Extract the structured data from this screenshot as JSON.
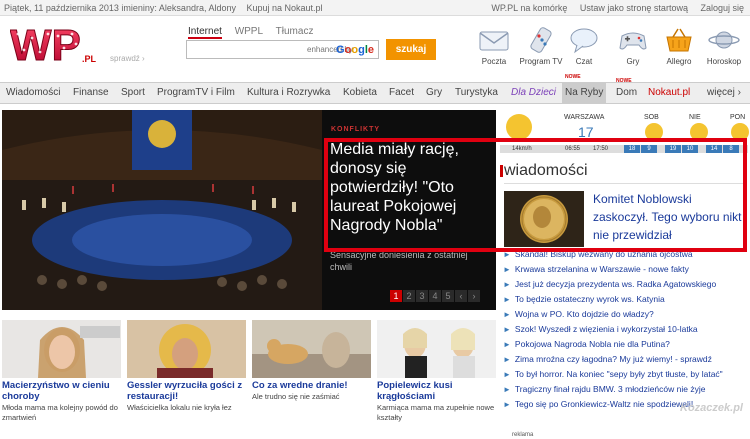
{
  "topbar": {
    "date": "Piątek, 11 października 2013 imieniny: Aleksandra, Aldony",
    "shop": "Kupuj na Nokaut.pl",
    "links": [
      "WP.PL na komórkę",
      "Ustaw jako stronę startową",
      "Zaloguj się"
    ]
  },
  "header": {
    "logo_text": "WP",
    "logo_suffix": ".PL",
    "logo_sub": "sprawdź ›",
    "search_tabs": [
      "Internet",
      "WPPL",
      "Tłumacz"
    ],
    "search_placeholder": "enhanced by",
    "google_letters": [
      "G",
      "o",
      "o",
      "g",
      "l",
      "e"
    ],
    "search_button": "szukaj",
    "services": [
      "Poczta",
      "Program TV",
      "Czat",
      "Gry",
      "Allegro",
      "Horoskop"
    ]
  },
  "nav": {
    "items": [
      "Wiadomości",
      "Finanse",
      "Sport",
      "ProgramTV i Film",
      "Kultura i Rozrywka",
      "Kobieta",
      "Facet",
      "Gry",
      "Turystyka",
      "Dla Dzieci",
      "Na Ryby",
      "Dom",
      "Nokaut.pl",
      "więcej ›"
    ],
    "new_badge": "NOWE"
  },
  "hero": {
    "category": "KONFLIKTY",
    "title": "Media miały rację, donosy się potwierdziły! \"Oto laureat Pokojowej Nagrody Nobla\"",
    "subtitle": "Sensacyjne doniesienia z ostatniej chwili",
    "pages": [
      "1",
      "2",
      "3",
      "4",
      "5",
      "‹",
      "›"
    ]
  },
  "weather": {
    "city": "WARSZAWA",
    "temp": "17",
    "days": [
      "SOB",
      "NIE",
      "PON"
    ],
    "bar": [
      "14km/h",
      "06:55",
      "17:50"
    ],
    "temps": [
      "18",
      "9",
      "19",
      "10",
      "14",
      "8"
    ]
  },
  "news": {
    "header": "wiadomości",
    "lead": "Komitet Noblowski zaskoczył. Tego wyboru nikt nie przewidział",
    "items": [
      "Skandal! Biskup wezwany do uznania ojcostwa",
      "Krwawa strzelanina w Warszawie - nowe fakty",
      "Jest już decyzja prezydenta ws. Radka Agatowskiego",
      "To będzie ostateczny wyrok ws. Katynia",
      "Wojna w PO. Kto dojdzie do władzy?",
      "Szok! Wyszedł z więzienia i wykorzystał 10-latka",
      "Pokojowa Nagroda Nobla nie dla Putina?",
      "Zima mroźna czy łagodna? My już wiemy! - sprawdź",
      "To był horror. Na koniec \"sepy były zbyt tłuste, by latać\"",
      "Tragiczny finał rajdu BMW. 3 młodzieńców nie żyje",
      "Tego się po Gronkiewicz-Waltz nie spodziewali!"
    ],
    "ad": "reklama"
  },
  "cards": [
    {
      "title": "Macierzyństwo w cieniu choroby",
      "desc": "Młoda mama ma kolejny powód do zmartwień"
    },
    {
      "title": "Gessler wyrzuciła gości z restauracji!",
      "desc": "Właścicielka lokalu nie kryła łez"
    },
    {
      "title": "Co za wredne dranie!",
      "desc": "Ale trudno się nie zaśmiać"
    },
    {
      "title": "Popielewicz kusi krągłościami",
      "desc": "Karmiąca mama ma zupełnie nowe kształty"
    }
  ],
  "watermark": "Kozaczek.pl",
  "colors": {
    "brand_red": "#c00",
    "accent_orange": "#f29300",
    "link_blue": "#1a3a9a",
    "highlight_box": "#e00010"
  }
}
